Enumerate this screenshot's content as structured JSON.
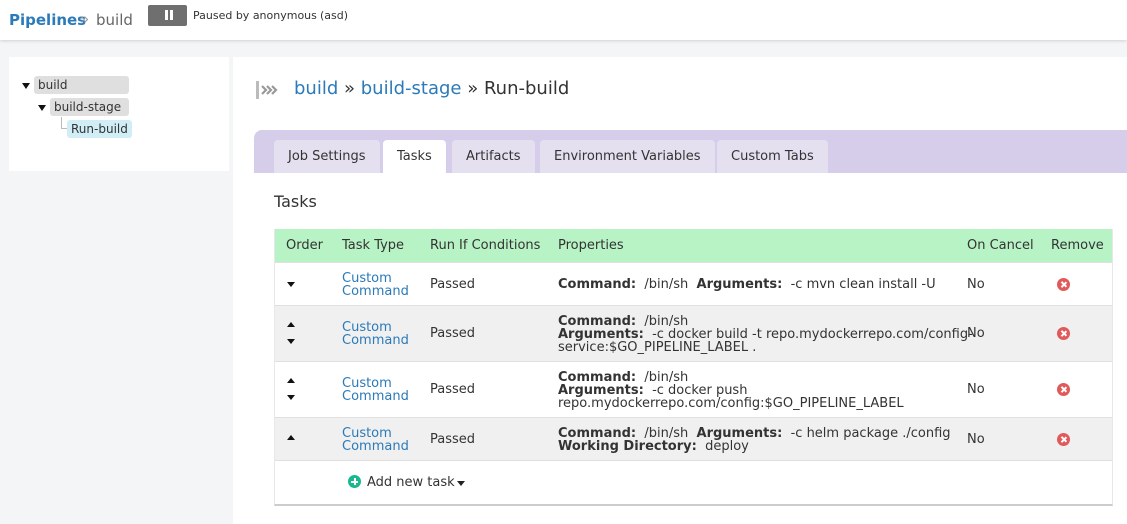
{
  "header": {
    "pipelines_link": "Pipelines",
    "separator": "»",
    "current": "build",
    "paused_text": "Paused by anonymous",
    "paused_reason": "(asd)"
  },
  "tree": {
    "pipeline": "build",
    "stage": "build-stage",
    "job": "Run-build"
  },
  "breadcrumb": {
    "pipeline": "build",
    "sep1": "»",
    "stage": "build-stage",
    "sep2": "»",
    "job": "Run-build"
  },
  "tabs": [
    {
      "label": "Job Settings"
    },
    {
      "label": "Tasks"
    },
    {
      "label": "Artifacts"
    },
    {
      "label": "Environment Variables"
    },
    {
      "label": "Custom Tabs"
    }
  ],
  "active_tab": "Tasks",
  "section_title": "Tasks",
  "table": {
    "headers": [
      "Order",
      "Task Type",
      "Run If Conditions",
      "Properties",
      "On Cancel",
      "Remove"
    ],
    "rows": [
      {
        "type_line1": "Custom",
        "type_line2": "Command",
        "run_if": "Passed",
        "prop_l1_k1": "Command:",
        "prop_l1_v1": "/bin/sh",
        "prop_l1_k2": "Arguments:",
        "prop_l1_v2": "-c mvn clean install -U",
        "on_cancel": "No"
      },
      {
        "type_line1": "Custom",
        "type_line2": "Command",
        "run_if": "Passed",
        "prop_l1_k1": "Command:",
        "prop_l1_v1": "/bin/sh",
        "prop_l2_k1": "Arguments:",
        "prop_l2_v1": "-c docker build -t repo.mydockerrepo.com/config-",
        "prop_l3": "service:$GO_PIPELINE_LABEL .",
        "on_cancel": "No"
      },
      {
        "type_line1": "Custom",
        "type_line2": "Command",
        "run_if": "Passed",
        "prop_l1_k1": "Command:",
        "prop_l1_v1": "/bin/sh",
        "prop_l2_k1": "Arguments:",
        "prop_l2_v1": "-c docker push",
        "prop_l3": "repo.mydockerrepo.com/config:$GO_PIPELINE_LABEL",
        "on_cancel": "No"
      },
      {
        "type_line1": "Custom",
        "type_line2": "Command",
        "run_if": "Passed",
        "prop_l1_k1": "Command:",
        "prop_l1_v1": "/bin/sh",
        "prop_l1_k2": "Arguments:",
        "prop_l1_v2": "-c helm package ./config",
        "prop_l2_k1": "Working Directory:",
        "prop_l2_v1": "deploy",
        "on_cancel": "No"
      }
    ]
  },
  "add_task_label": "Add new task",
  "colors": {
    "link": "#2b7ab9",
    "tab_bar": "#d6cdeb",
    "table_header": "#b8f3c5",
    "remove": "#e05a5a",
    "add": "#19b88e"
  }
}
